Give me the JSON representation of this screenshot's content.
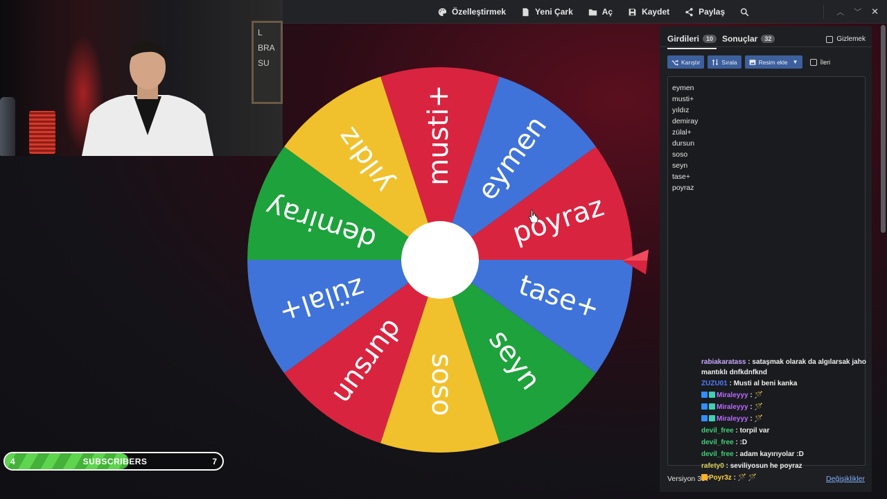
{
  "toolbar": {
    "items": [
      {
        "label": "Özelleştirmek",
        "icon": "palette-icon"
      },
      {
        "label": "Yeni Çark",
        "icon": "file-icon"
      },
      {
        "label": "Aç",
        "icon": "folder-icon"
      },
      {
        "label": "Kaydet",
        "icon": "save-icon"
      },
      {
        "label": "Paylaş",
        "icon": "share-icon"
      }
    ],
    "search_icon": "search-icon",
    "window_controls": [
      "chevron-up-icon",
      "chevron-down-icon",
      "close-icon"
    ]
  },
  "wheel": {
    "segments": [
      {
        "label": "musti+",
        "color": "#d9243f"
      },
      {
        "label": "eymen",
        "color": "#3f73d9"
      },
      {
        "label": "poyraz",
        "color": "#d9243f"
      },
      {
        "label": "tase+",
        "color": "#3f73d9"
      },
      {
        "label": "seyn",
        "color": "#1ea23c"
      },
      {
        "label": "soso",
        "color": "#f0c12c"
      },
      {
        "label": "dursun",
        "color": "#d9243f"
      },
      {
        "label": "zülal+",
        "color": "#3f73d9"
      },
      {
        "label": "demiray",
        "color": "#1ea23c"
      },
      {
        "label": "yıldız",
        "color": "#f0c12c"
      }
    ],
    "pointer_color": "#d9243f"
  },
  "panel": {
    "tabs": [
      {
        "label": "Girdileri",
        "count": "10",
        "active": true
      },
      {
        "label": "Sonuçlar",
        "count": "32",
        "active": false
      }
    ],
    "hide_label": "Gizlemek",
    "buttons": {
      "shuffle": "Karıştır",
      "sort": "Sırala",
      "add_image": "Resim ekle"
    },
    "advanced_label": "İleri",
    "entries": [
      "eymen",
      "musti+",
      "yıldız",
      "demiray",
      "zülal+",
      "dursun",
      "soso",
      "seyn",
      "tase+",
      "poyraz"
    ],
    "version": "Versiyon 397",
    "changes_link": "Değişiklikler"
  },
  "chat": [
    {
      "user": "rabiakaratass",
      "color": "#c9a6ff",
      "text": "sataşmak olarak da algılarsak jaho mantıklı dnfkdnfknd"
    },
    {
      "user": "ZUZU01",
      "color": "#4f7dff",
      "text": "Musti al beni kanka"
    },
    {
      "user": "Miraleyyy",
      "color": "#b86bff",
      "text": "🪄"
    },
    {
      "user": "Miraleyyy",
      "color": "#b86bff",
      "text": "🪄"
    },
    {
      "user": "Miraleyyy",
      "color": "#b86bff",
      "text": "🪄"
    },
    {
      "user": "devil_free",
      "color": "#3fd07a",
      "text": "torpil var"
    },
    {
      "user": "devil_free",
      "color": "#3fd07a",
      "text": ":D"
    },
    {
      "user": "devil_free",
      "color": "#3fd07a",
      "text": "adam kayırıyolar :D"
    },
    {
      "user": "rafety0",
      "color": "#d8d15a",
      "text": "seviliyosun he poyraz"
    },
    {
      "user": "Poyr3z",
      "color": "#ffd43a",
      "text": "🪄 🪄"
    }
  ],
  "webcam": {
    "board_text": [
      "L",
      "BRA",
      "SU"
    ]
  },
  "subscribers": {
    "label": "SUBSCRIBERS",
    "current": "4",
    "goal": "7",
    "progress": 0.57
  }
}
